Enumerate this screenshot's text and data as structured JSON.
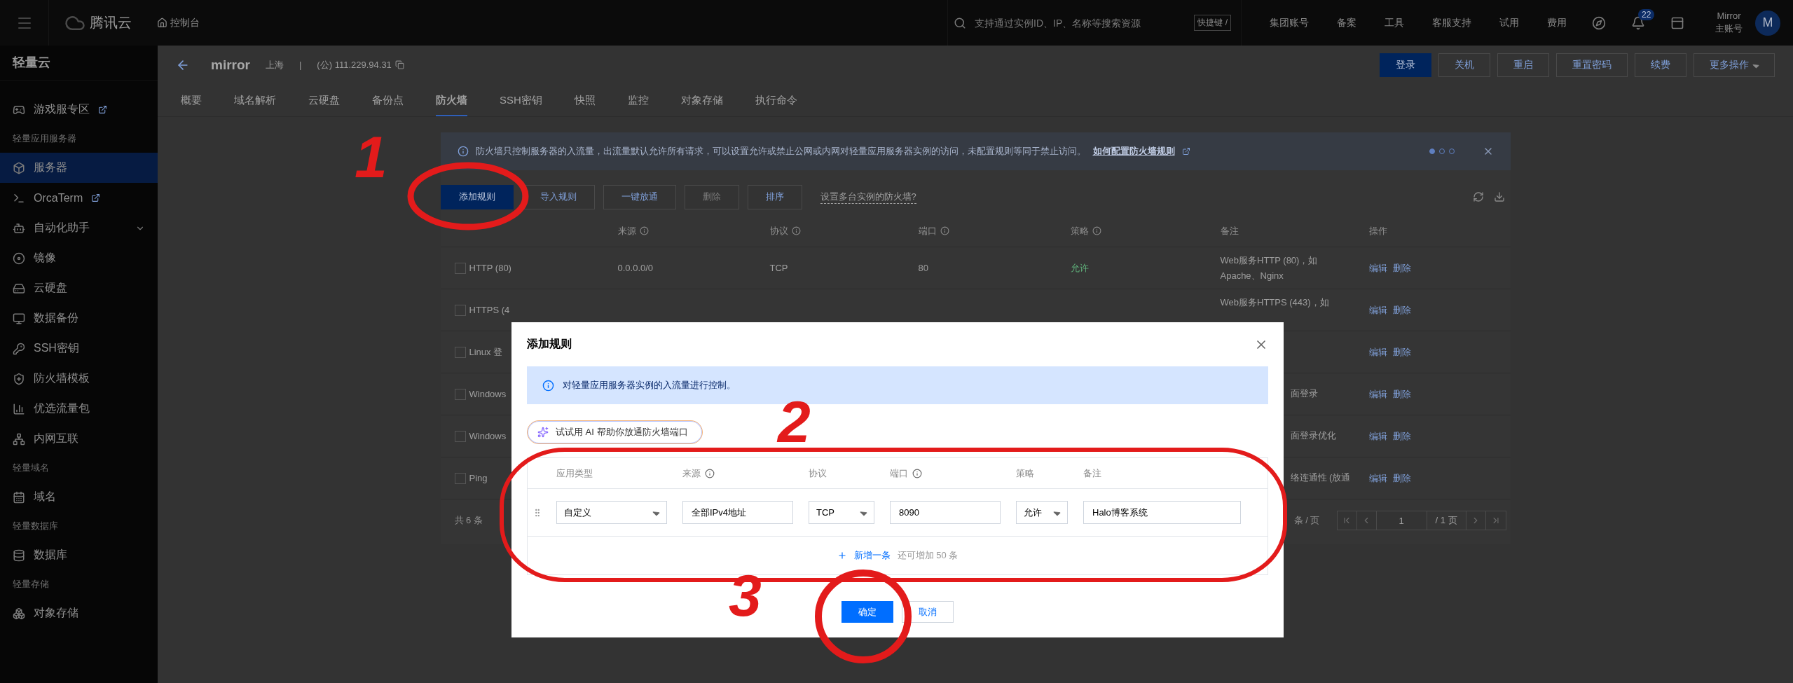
{
  "topbar": {
    "brand": "腾讯云",
    "console": "控制台",
    "search": {
      "placeholder": "支持通过实例ID、IP、名称等搜索资源"
    },
    "shortcut": "快捷键 /",
    "nav": [
      "集团账号",
      "备案",
      "工具",
      "客服支持",
      "试用",
      "费用"
    ],
    "notifications": "22",
    "user": {
      "name": "Mirror",
      "role": "主账号",
      "avatar": "M"
    }
  },
  "sidebar": {
    "title": "轻量云",
    "groups": [
      {
        "items": [
          {
            "label": "游戏服专区",
            "external": true,
            "selected": false
          }
        ]
      },
      {
        "title": "轻量应用服务器",
        "items": [
          {
            "label": "服务器",
            "selected": true
          },
          {
            "label": "OrcaTerm",
            "external": true,
            "selected": false
          },
          {
            "label": "自动化助手",
            "expandable": true,
            "selected": false
          },
          {
            "label": "镜像",
            "selected": false
          },
          {
            "label": "云硬盘",
            "selected": false
          },
          {
            "label": "数据备份",
            "selected": false
          },
          {
            "label": "SSH密钥",
            "selected": false
          },
          {
            "label": "防火墙模板",
            "selected": false
          },
          {
            "label": "优选流量包",
            "selected": false
          },
          {
            "label": "内网互联",
            "selected": false
          }
        ]
      },
      {
        "title": "轻量域名",
        "items": [
          {
            "label": "域名",
            "selected": false
          }
        ]
      },
      {
        "title": "轻量数据库",
        "items": [
          {
            "label": "数据库",
            "selected": false
          }
        ]
      },
      {
        "title": "轻量存储",
        "items": [
          {
            "label": "对象存储",
            "selected": false
          }
        ]
      }
    ]
  },
  "instance": {
    "name": "mirror",
    "region": "上海",
    "separator": "|",
    "ip": "(公) 111.229.94.31",
    "actions": [
      {
        "label": "登录",
        "primary": true
      },
      {
        "label": "关机",
        "primary": false
      },
      {
        "label": "重启",
        "primary": false
      },
      {
        "label": "重置密码",
        "primary": false
      },
      {
        "label": "续费",
        "primary": false
      },
      {
        "label": "更多操作",
        "primary": false,
        "dropdown": true
      }
    ]
  },
  "tabs": [
    {
      "label": "概要",
      "selected": false
    },
    {
      "label": "域名解析",
      "selected": false
    },
    {
      "label": "云硬盘",
      "selected": false
    },
    {
      "label": "备份点",
      "selected": false
    },
    {
      "label": "防火墙",
      "selected": true
    },
    {
      "label": "SSH密钥",
      "selected": false
    },
    {
      "label": "快照",
      "selected": false
    },
    {
      "label": "监控",
      "selected": false
    },
    {
      "label": "对象存储",
      "selected": false
    },
    {
      "label": "执行命令",
      "selected": false
    }
  ],
  "firewall": {
    "notice": {
      "text": "防火墙只控制服务器的入流量，出流量默认允许所有请求，可以设置允许或禁止公网或内网对轻量应用服务器实例的访问，未配置规则等同于禁止访问。",
      "link": "如何配置防火墙规则",
      "pages": [
        {
          "selected": true
        },
        {
          "selected": false
        },
        {
          "selected": false
        }
      ]
    },
    "toolbar": [
      {
        "label": "添加规则",
        "primary": true,
        "disabled": false
      },
      {
        "label": "导入规则",
        "primary": false,
        "disabled": false
      },
      {
        "label": "一键放通",
        "primary": false,
        "disabled": false
      },
      {
        "label": "删除",
        "primary": false,
        "disabled": true
      },
      {
        "label": "排序",
        "primary": false,
        "disabled": false
      }
    ],
    "help_link": "设置多台实例的防火墙?",
    "columns": [
      {
        "label": "来源",
        "info": true
      },
      {
        "label": "协议",
        "info": true
      },
      {
        "label": "端口",
        "info": true
      },
      {
        "label": "策略",
        "info": true
      },
      {
        "label": "备注"
      },
      {
        "label": "操作"
      }
    ],
    "rows": [
      {
        "checked": false,
        "name": "HTTP (80)",
        "source": "0.0.0.0/0",
        "protocol": "TCP",
        "port": "80",
        "policy": "允许",
        "remark": [
          "Web服务HTTP (80)，如",
          "Apache、Nginx"
        ],
        "actions": [
          "编辑",
          "删除"
        ]
      },
      {
        "checked": false,
        "name": "HTTPS (4",
        "remark": [
          "Web服务HTTPS (443)，如"
        ],
        "actions": [
          "编辑",
          "删除"
        ]
      },
      {
        "checked": false,
        "name": "Linux 登",
        "actions": [
          "编辑",
          "删除"
        ]
      },
      {
        "checked": false,
        "name": "Windows",
        "remark": [
          "面登录"
        ],
        "remark_clipped": true,
        "actions": [
          "编辑",
          "删除"
        ]
      },
      {
        "checked": false,
        "name": "Windows",
        "remark": [
          "面登录优化"
        ],
        "remark_clipped": true,
        "actions": [
          "编辑",
          "删除"
        ]
      },
      {
        "checked": false,
        "name": "Ping",
        "remark": [
          "络连通性 (放通"
        ],
        "remark_clipped": true,
        "actions": [
          "编辑",
          "删除"
        ]
      }
    ],
    "pagination": {
      "total": "共 6 条",
      "page_size": "条 / 页",
      "page": "1",
      "pages": "/ 1 页"
    }
  },
  "modal": {
    "title": "添加规则",
    "notice": "对轻量应用服务器实例的入流量进行控制。",
    "ai_button": "试试用 AI 帮助你放通防火墙端口",
    "columns": [
      {
        "label": "应用类型"
      },
      {
        "label": "来源",
        "info": true
      },
      {
        "label": "协议"
      },
      {
        "label": "端口",
        "info": true
      },
      {
        "label": "策略"
      },
      {
        "label": "备注"
      }
    ],
    "rules": [
      {
        "fields": [
          {
            "kind": "select",
            "value": "自定义"
          },
          {
            "kind": "input",
            "value": "全部IPv4地址"
          },
          {
            "kind": "select",
            "value": "TCP"
          },
          {
            "kind": "input",
            "value": "8090"
          },
          {
            "kind": "select",
            "value": "允许"
          },
          {
            "kind": "input",
            "value": "Halo博客系统"
          }
        ]
      }
    ],
    "add_link": "新增一条",
    "add_hint": "还可增加 50 条",
    "buttons": [
      {
        "label": "确定",
        "primary": true
      },
      {
        "label": "取消",
        "primary": false
      }
    ]
  },
  "annotations": {
    "numbers": [
      "1",
      "2",
      "3"
    ]
  }
}
